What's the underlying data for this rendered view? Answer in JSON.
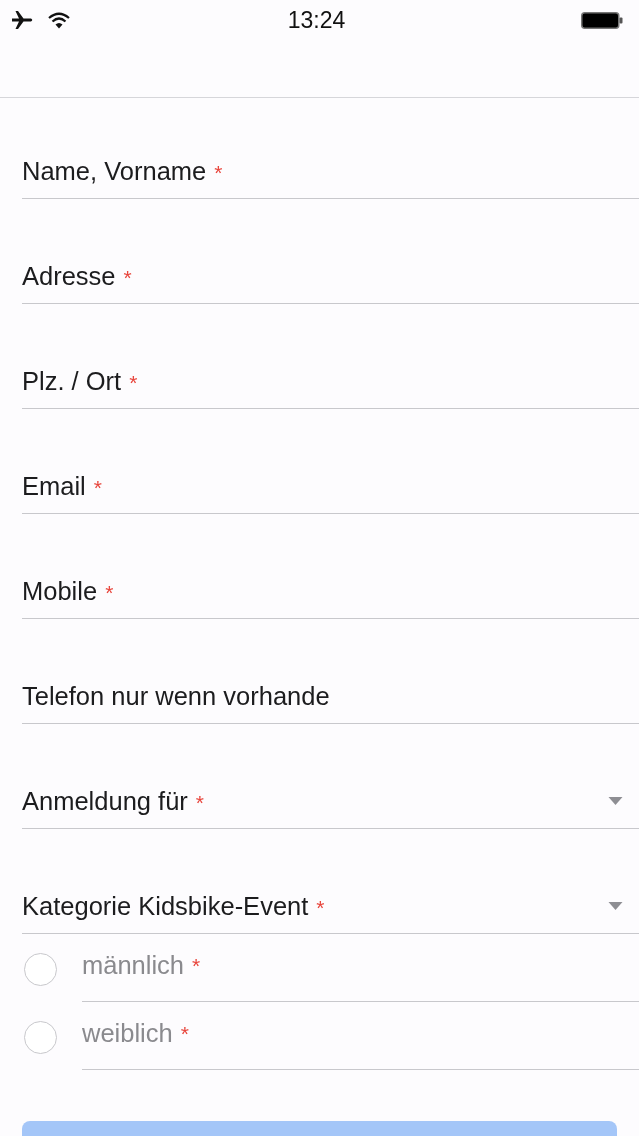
{
  "status_bar": {
    "time": "13:24"
  },
  "fields": [
    {
      "kind": "text",
      "placeholder": "Name, Vorname",
      "required_mark": "*"
    },
    {
      "kind": "text",
      "placeholder": "Adresse",
      "required_mark": "*"
    },
    {
      "kind": "text",
      "placeholder": "Plz. / Ort",
      "required_mark": "*"
    },
    {
      "kind": "text",
      "placeholder": "Email",
      "required_mark": "*"
    },
    {
      "kind": "text",
      "placeholder": "Mobile",
      "required_mark": "*"
    },
    {
      "kind": "text",
      "placeholder": "Telefon nur wenn vorhande"
    },
    {
      "kind": "select",
      "placeholder": "Anmeldung für",
      "required_mark": "*"
    },
    {
      "kind": "select",
      "placeholder": "Kategorie Kidsbike-Event",
      "required_mark": "*"
    }
  ],
  "gender_options": [
    {
      "label": "männlich",
      "required_mark": "*",
      "selected": false
    },
    {
      "label": "weiblich",
      "required_mark": "*",
      "selected": false
    }
  ],
  "submit_button": {
    "disabled": true
  }
}
